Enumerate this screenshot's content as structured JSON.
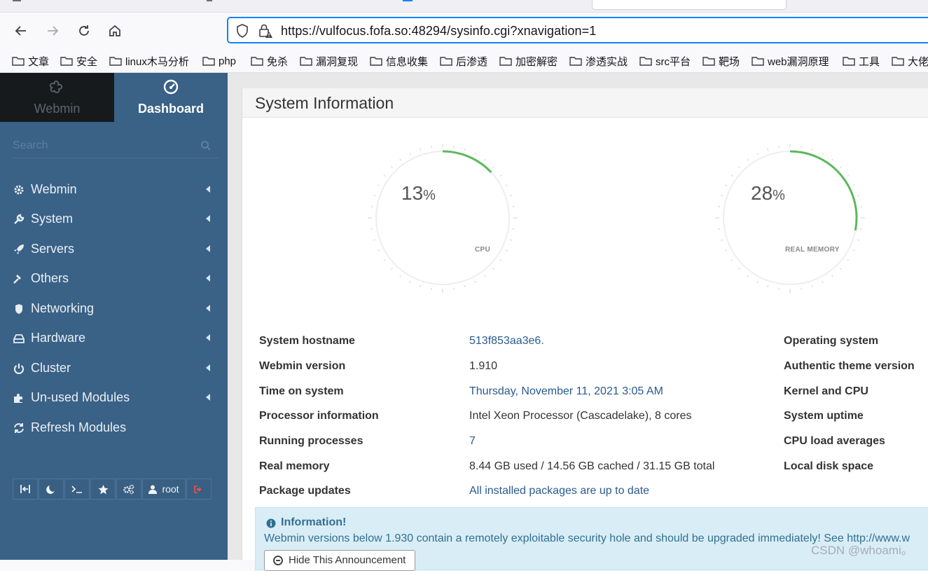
{
  "browser": {
    "url": "https://vulfocus.fofa.so:48294/sysinfo.cgi?xnavigation=1",
    "bookmarks": [
      "文章",
      "安全",
      "linux木马分析",
      "php",
      "免杀",
      "漏洞复现",
      "信息收集",
      "后渗透",
      "加密解密",
      "渗透实战",
      "src平台",
      "靶场",
      "web漏洞原理",
      "工具",
      "大佬"
    ]
  },
  "sidebar": {
    "webmin_tab": "Webmin",
    "dashboard_tab": "Dashboard",
    "search_placeholder": "Search",
    "items": [
      {
        "label": "Webmin",
        "icon": "cogs-icon"
      },
      {
        "label": "System",
        "icon": "wrench-icon"
      },
      {
        "label": "Servers",
        "icon": "rocket-icon"
      },
      {
        "label": "Others",
        "icon": "gavel-icon"
      },
      {
        "label": "Networking",
        "icon": "shield-icon"
      },
      {
        "label": "Hardware",
        "icon": "hdd-icon"
      },
      {
        "label": "Cluster",
        "icon": "power-icon"
      },
      {
        "label": "Un-used Modules",
        "icon": "puzzle-icon"
      },
      {
        "label": "Refresh Modules",
        "icon": "refresh-icon"
      }
    ],
    "bottom": {
      "user": "root"
    }
  },
  "main": {
    "title": "System Information",
    "cpu": {
      "value": "13",
      "unit": "%",
      "label": "CPU",
      "percent": 13
    },
    "memory": {
      "value": "28",
      "unit": "%",
      "label": "REAL MEMORY",
      "percent": 28
    },
    "rows": [
      {
        "label": "System hostname",
        "value": "513f853aa3e6.",
        "link": true
      },
      {
        "label": "Webmin version",
        "value": "1.910",
        "link": false
      },
      {
        "label": "Time on system",
        "value": "Thursday, November 11, 2021 3:05 AM",
        "link": true
      },
      {
        "label": "Processor information",
        "value": "Intel Xeon Processor (Cascadelake), 8 cores",
        "link": false
      },
      {
        "label": "Running processes",
        "value": "7",
        "link": true
      },
      {
        "label": "Real memory",
        "value": "8.44 GB used / 14.56 GB cached / 31.15 GB total",
        "link": false
      },
      {
        "label": "Package updates",
        "value": "All installed packages are up to date",
        "link": true
      }
    ],
    "right_labels": [
      "Operating system",
      "Authentic theme version",
      "Kernel and CPU",
      "System uptime",
      "CPU load averages",
      "Local disk space"
    ],
    "alert": {
      "title": "Information!",
      "message": "Webmin versions below 1.930 contain a remotely exploitable security hole and should be upgraded immediately! See http://www.w",
      "button": "Hide This Announcement"
    }
  },
  "watermark": "CSDN @whoami。",
  "colors": {
    "sidebar": "#3a6186",
    "gauge": "#5cb85c",
    "link": "#2a5a8f"
  }
}
